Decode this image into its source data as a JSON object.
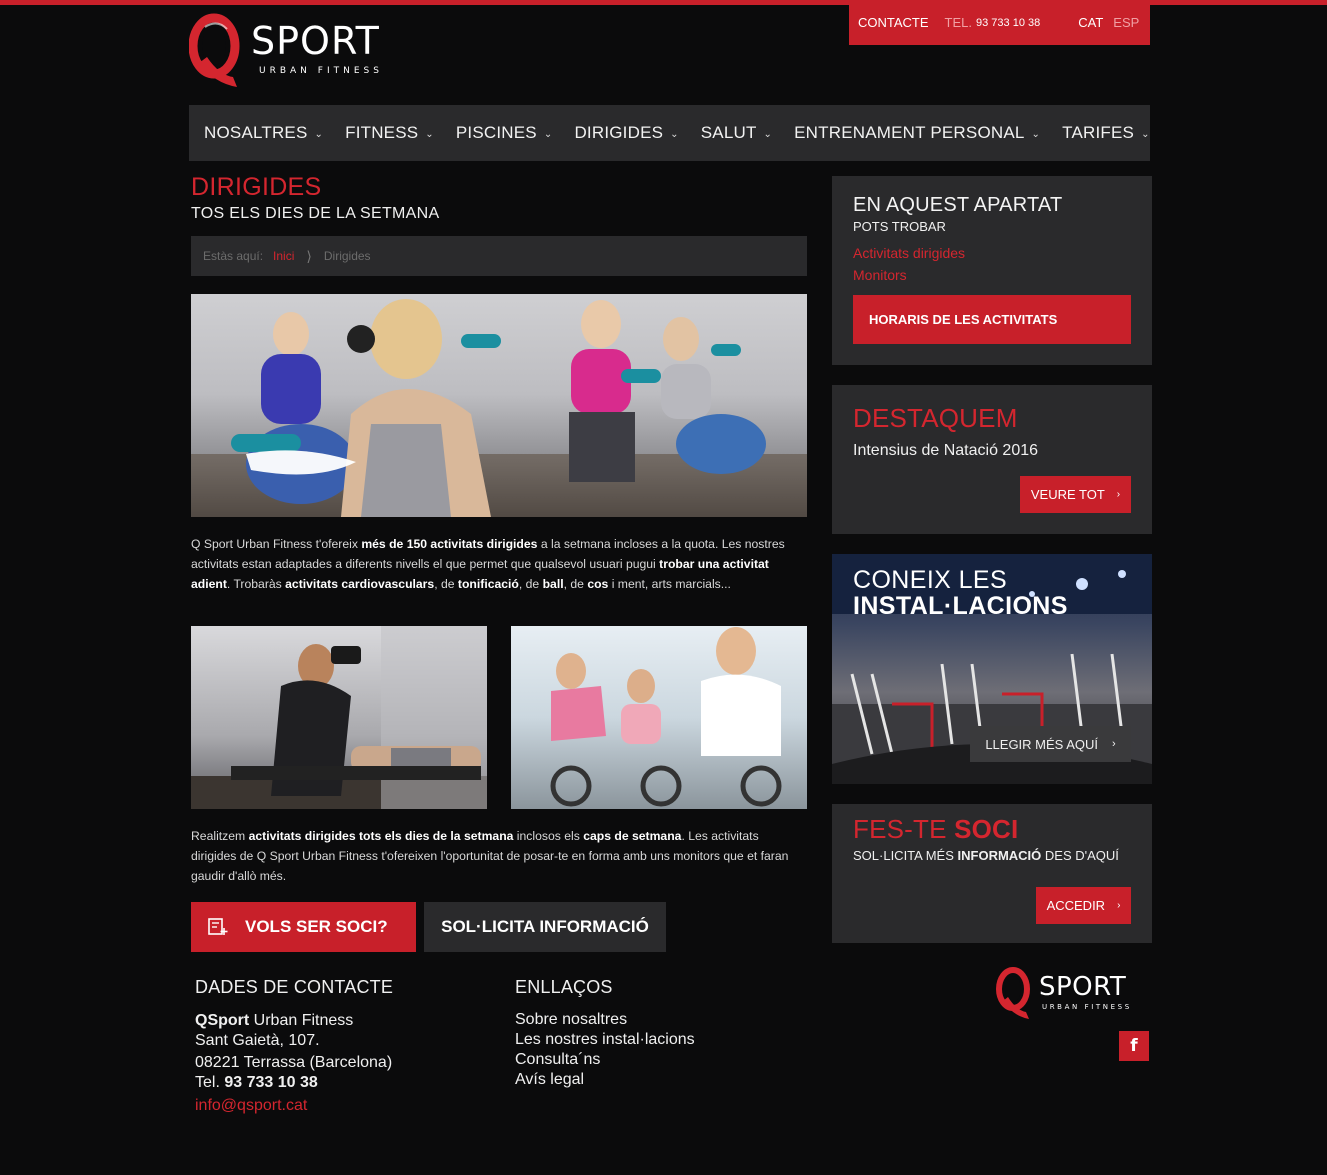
{
  "brand": {
    "name": "SPORT",
    "tagline": "URBAN FITNESS",
    "logo_letter": "Q",
    "accent": "#c8202a"
  },
  "topbar": {
    "contact_label": "CONTACTE",
    "tel_label": "TEL.",
    "tel_number": "93 733 10 38",
    "lang_active": "CAT",
    "lang_other": "ESP"
  },
  "nav": [
    {
      "label": "NOSALTRES"
    },
    {
      "label": "FITNESS"
    },
    {
      "label": "PISCINES"
    },
    {
      "label": "DIRIGIDES"
    },
    {
      "label": "SALUT"
    },
    {
      "label": "ENTRENAMENT PERSONAL"
    },
    {
      "label": "TARIFES"
    }
  ],
  "main": {
    "title": "DIRIGIDES",
    "subtitle": "TOS ELS DIES DE LA SETMANA",
    "breadcrumb": {
      "prefix": "Estàs aquí:",
      "home": "Inici",
      "current": "Dirigides"
    },
    "para1": {
      "t1": "Q Sport Urban Fitness t'ofereix ",
      "b1": "més de 150 activitats dirigides",
      "t2": " a la setmana incloses a la quota. Les nostres activitats estan adaptades a diferents nivells el que permet que qualsevol usuari pugui ",
      "b2": "trobar una activitat adient",
      "t3": ". Trobaràs ",
      "b3": "activitats cardiovasculars",
      "t4": ", de ",
      "b4": "tonificació",
      "t5": ", de ",
      "b5": "ball",
      "t6": ", de ",
      "b6": "cos",
      "t7": " i ment, arts marcials..."
    },
    "para2": {
      "t1": "Realitzem ",
      "b1": "activitats dirigides tots els dies de la setmana",
      "t2": " inclosos els ",
      "b2": "caps de setmana",
      "t3": ".  Les activitats dirigides de Q Sport Urban Fitness t'ofereixen l'oportunitat de posar-te en forma amb uns monitors que et faran gaudir d'allò més."
    },
    "cta_member": "VOLS SER SOCI?",
    "cta_info": "SOL·LICITA INFORMACIÓ"
  },
  "sidebar": {
    "section": {
      "title": "EN AQUEST APARTAT",
      "subtitle": "POTS TROBAR",
      "links": [
        "Activitats dirigides",
        "Monitors"
      ],
      "button": "HORARIS DE LES ACTIVITATS"
    },
    "featured": {
      "title": "DESTAQUEM",
      "text": "Intensius de Natació 2016",
      "button": "VEURE TOT"
    },
    "facilities": {
      "line1": "CONEIX LES",
      "line2": "INSTAL·LACIONS",
      "button": "LLEGIR MÉS AQUÍ"
    },
    "join": {
      "title_a": "FES-TE ",
      "title_b": "SOCI",
      "text_a": "SOL·LICITA MÉS ",
      "text_b": "INFORMACIÓ",
      "text_c": " DES D'AQUÍ",
      "button": "ACCEDIR"
    }
  },
  "footer": {
    "contact": {
      "title": "DADES DE CONTACTE",
      "name_bold": "QSport",
      "name_rest": " Urban Fitness",
      "street": "Sant Gaietà, 107.",
      "city": "08221 Terrassa (Barcelona)",
      "tel_label": "Tel. ",
      "tel": "93 733 10 38",
      "email": "info@qsport.cat"
    },
    "links": {
      "title": "ENLLAÇOS",
      "items": [
        "Sobre nosaltres",
        "Les nostres instal·lacions",
        "Consulta´ns",
        "Avís legal"
      ]
    },
    "social": {
      "facebook_glyph": "f"
    }
  }
}
